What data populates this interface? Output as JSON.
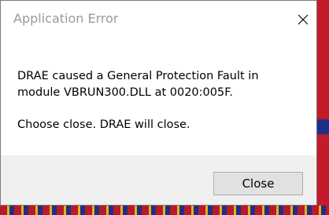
{
  "dialog": {
    "title": "Application Error",
    "close_icon": "close-icon",
    "message_line1": "DRAE caused a General Protection Fault in",
    "message_line2": "module VBRUN300.DLL at 0020:005F.",
    "message_line3": "Choose close. DRAE will close.",
    "close_button_label": "Close"
  },
  "colors": {
    "title_text": "#9a9a9a",
    "footer_bg": "#f0f0f0",
    "button_bg": "#e1e1e1",
    "button_border": "#adadad"
  }
}
